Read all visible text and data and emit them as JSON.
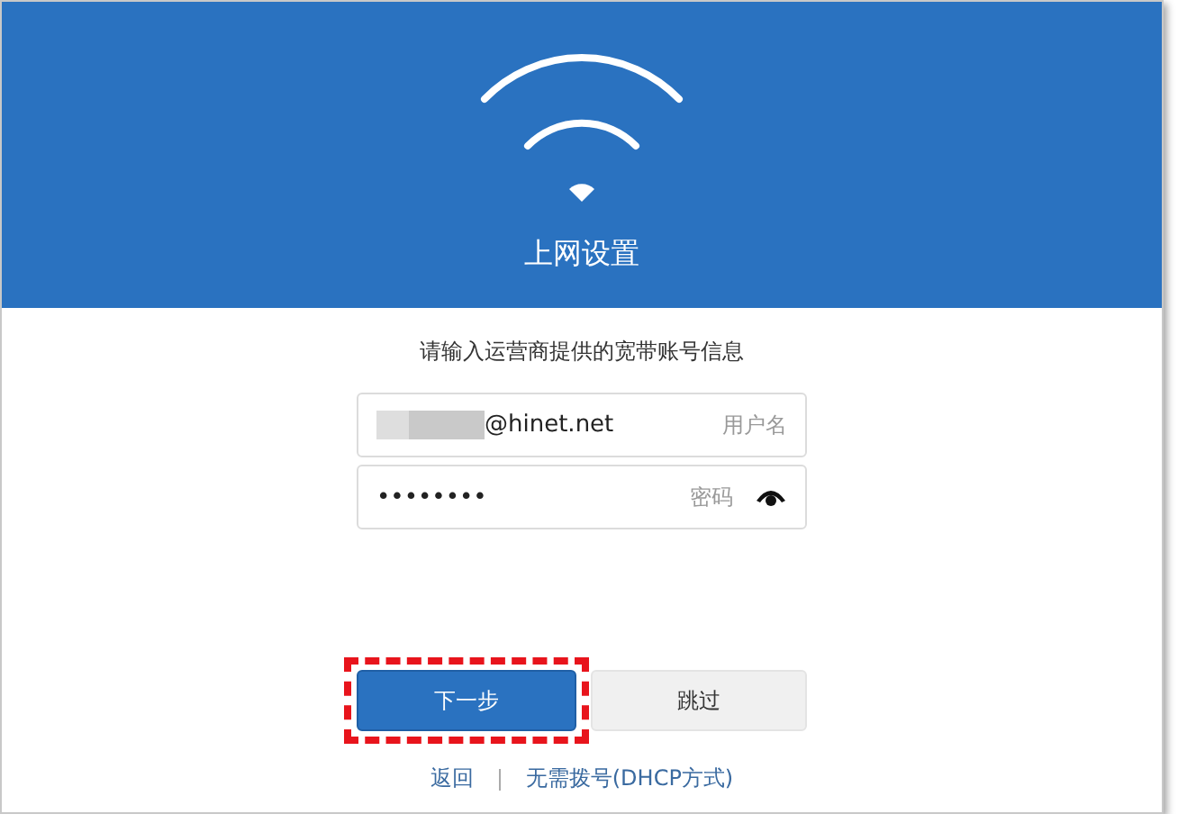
{
  "header": {
    "title": "上网设置"
  },
  "prompt": "请输入运营商提供的宽带账号信息",
  "fields": [
    {
      "kind": "account",
      "value": "@hinet.net",
      "label": "用户名",
      "redacted": true
    },
    {
      "kind": "password",
      "value": "••••••••",
      "label": "密码",
      "redacted": false
    }
  ],
  "buttons": [
    {
      "label": "下一步",
      "kind": "primary",
      "highlighted": true
    },
    {
      "label": "跳过",
      "kind": "secondary",
      "highlighted": false
    }
  ],
  "links": [
    {
      "label": "返回"
    },
    {
      "label": "无需拨号(DHCP方式)"
    }
  ]
}
